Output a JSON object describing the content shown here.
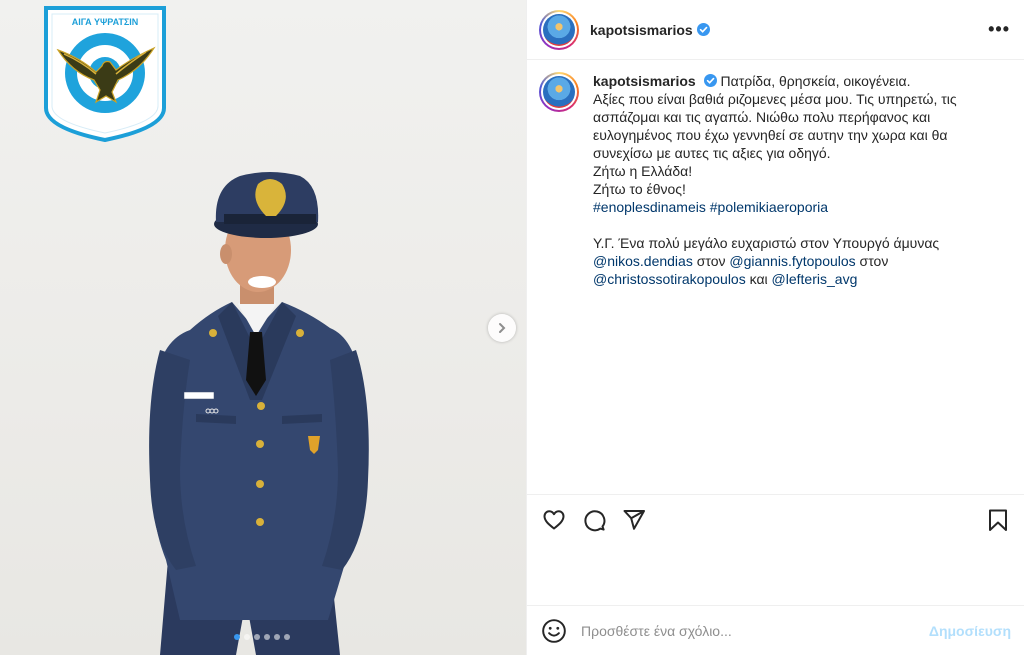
{
  "post": {
    "username": "kapotsismarios",
    "verified": true,
    "more_icon": "more-horizontal-icon"
  },
  "media": {
    "badge_text": "ΑΙΓΑ ΥΨΡΑΤΣΙΝ",
    "carousel_dots": 6,
    "active_dot": 0,
    "accent_color": "#3897f0"
  },
  "caption": {
    "username": "kapotsismarios",
    "lines": [
      "Πατρίδα, θρησκεία, οικογένεια.",
      "Αξίες που είναι βαθιά ριζομενες μέσα μου. Τις υπηρετώ, τις",
      "ασπάζομαι και τις αγαπώ. Νιώθω πολυ περήφανος και",
      "ευλογημένος που έχω γεννηθεί σε αυτην την χωρα και θα",
      "συνεχίσω με αυτες τις αξιες για οδηγό.",
      "Ζήτω η Ελλάδα!",
      "Ζήτω το έθνος!"
    ],
    "hashtags": [
      "#enoplesdinameis",
      "#polemikiaeroporia"
    ],
    "ps_text": "Υ.Γ. Ένα πολύ μεγάλο ευχαριστώ στον Υπουργό άμυνας",
    "mention_1": "@nikos.dendias",
    "word_ston_1": " στον ",
    "mention_2": "@giannis.fytopoulos",
    "word_ston_2": " στον",
    "mention_3": "@christossotirakopoulos",
    "word_kai": " και ",
    "mention_4": "@lefteris_avg"
  },
  "comment": {
    "placeholder": "Προσθέστε ένα σχόλιο...",
    "post_label": "Δημοσίευση"
  }
}
